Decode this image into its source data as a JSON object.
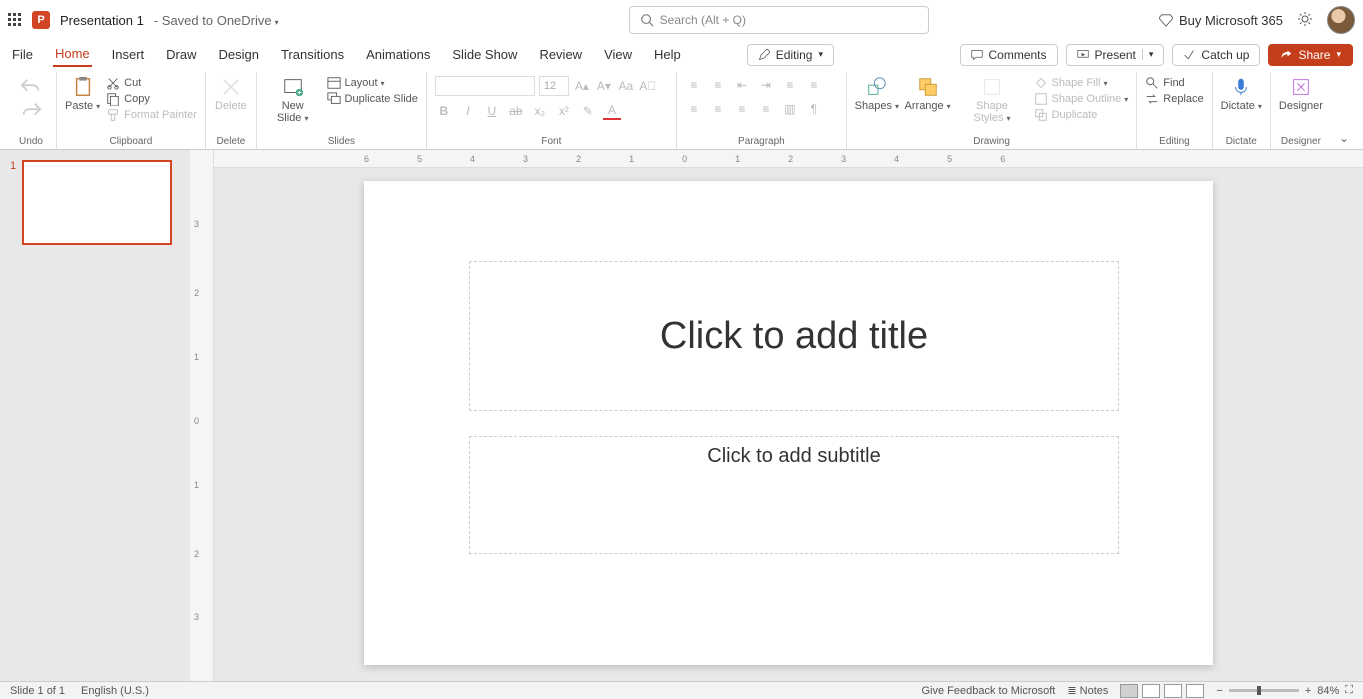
{
  "title": {
    "doc_name": "Presentation 1",
    "save_state": "- Saved to OneDrive",
    "search_placeholder": "Search (Alt + Q)",
    "buy": "Buy Microsoft 365"
  },
  "tabs": {
    "file": "File",
    "home": "Home",
    "insert": "Insert",
    "draw": "Draw",
    "design": "Design",
    "transitions": "Transitions",
    "animations": "Animations",
    "slideshow": "Slide Show",
    "review": "Review",
    "view": "View",
    "help": "Help",
    "editing": "Editing"
  },
  "tabs_right": {
    "comments": "Comments",
    "present": "Present",
    "catchup": "Catch up",
    "share": "Share"
  },
  "ribbon": {
    "undo": {
      "undo": "Undo",
      "label": "Undo"
    },
    "clipboard": {
      "paste": "Paste",
      "cut": "Cut",
      "copy": "Copy",
      "format_painter": "Format Painter",
      "label": "Clipboard"
    },
    "delete": {
      "delete": "Delete",
      "label": "Delete"
    },
    "slides": {
      "new_slide": "New Slide",
      "layout": "Layout",
      "duplicate": "Duplicate Slide",
      "label": "Slides"
    },
    "font": {
      "size": "12",
      "label": "Font"
    },
    "paragraph": {
      "label": "Paragraph"
    },
    "drawing": {
      "shapes": "Shapes",
      "arrange": "Arrange",
      "shape_styles": "Shape Styles",
      "shape_fill": "Shape Fill",
      "shape_outline": "Shape Outline",
      "duplicate": "Duplicate",
      "label": "Drawing"
    },
    "editing": {
      "find": "Find",
      "replace": "Replace",
      "label": "Editing"
    },
    "dictate": {
      "dictate": "Dictate",
      "label": "Dictate"
    },
    "designer": {
      "designer": "Designer",
      "label": "Designer"
    }
  },
  "thumbs": {
    "num1": "1"
  },
  "slide": {
    "title_placeholder": "Click to add title",
    "subtitle_placeholder": "Click to add subtitle"
  },
  "ruler_top": [
    "6",
    "5",
    "4",
    "3",
    "2",
    "1",
    "0",
    "1",
    "2",
    "3",
    "4",
    "5",
    "6"
  ],
  "ruler_left": [
    "3",
    "2",
    "1",
    "0",
    "1",
    "2",
    "3"
  ],
  "status": {
    "slide": "Slide 1 of 1",
    "lang": "English (U.S.)",
    "feedback": "Give Feedback to Microsoft",
    "notes": "Notes",
    "zoom": "84%"
  }
}
